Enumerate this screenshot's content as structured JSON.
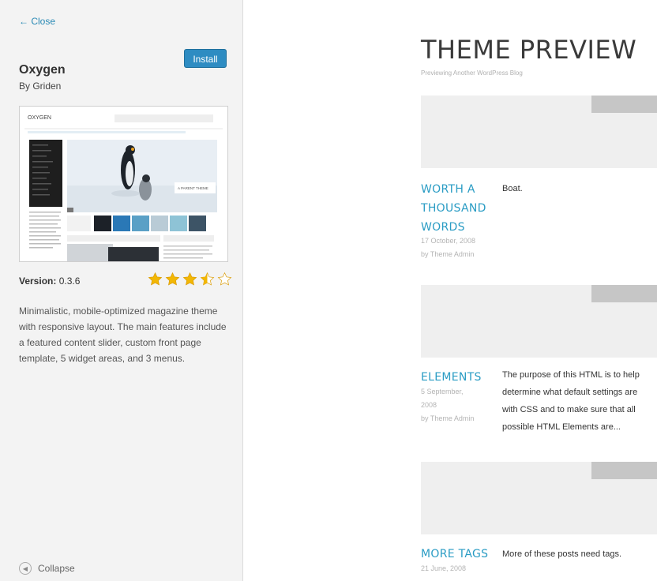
{
  "sidebar": {
    "close_label": "← Close",
    "install_label": "Install",
    "theme_name": "Oxygen",
    "theme_author": "By Griden",
    "version_label": "Version:",
    "version_value": "0.3.6",
    "rating": 3.5,
    "rating_max": 5,
    "description": "Minimalistic, mobile-optimized magazine theme with responsive layout. The main features include a featured content slider, custom front page template, 5 widget areas, and 3 menus.",
    "collapse_label": "Collapse",
    "screenshot_logo": "OXYGEN",
    "screenshot_caption": "A PARENT THEME"
  },
  "preview": {
    "title": "THEME PREVIEW",
    "subtitle": "Previewing Another WordPress Blog",
    "posts": [
      {
        "title_lines": [
          "WORTH A",
          "THOUSAND",
          "WORDS"
        ],
        "date": "17 October, 2008",
        "author": "by Theme Admin",
        "excerpt_lines": [
          "Boat."
        ]
      },
      {
        "title_lines": [
          "ELEMENTS"
        ],
        "date_lines": [
          "5 September,",
          "2008"
        ],
        "author": "by Theme Admin",
        "excerpt_lines": [
          "The purpose of this HTML is to help",
          "determine what default settings are",
          "with CSS and to make sure that all",
          "possible HTML Elements are..."
        ]
      },
      {
        "title_lines": [
          "MORE TAGS"
        ],
        "date": "21 June, 2008",
        "excerpt_lines": [
          "More of these posts need tags."
        ]
      }
    ]
  },
  "colors": {
    "accent": "#2a9cc4",
    "install_button": "#2e8cc2",
    "sidebar_bg": "#f3f3f3",
    "star": "#f2b705"
  },
  "icons": {
    "collapse": "collapse-left-icon",
    "star_full": "star-full-icon",
    "star_half": "star-half-icon",
    "star_empty": "star-empty-icon"
  }
}
